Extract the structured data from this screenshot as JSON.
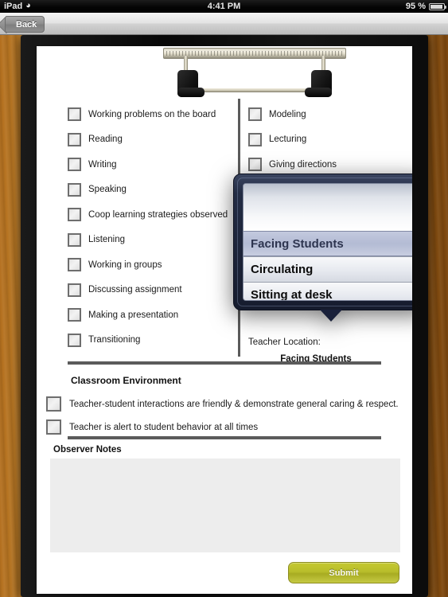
{
  "status_bar": {
    "carrier": "iPad",
    "wifi_icon": "wifi-icon",
    "time": "4:41 PM",
    "battery_percent": "95 %",
    "battery_icon": "battery-icon"
  },
  "nav_bar": {
    "back_label": "Back"
  },
  "form": {
    "left_column": [
      {
        "label": "Working problems on the board",
        "checked": false
      },
      {
        "label": "Reading",
        "checked": false
      },
      {
        "label": "Writing",
        "checked": false
      },
      {
        "label": "Speaking",
        "checked": false
      },
      {
        "label": "Coop learning strategies observed",
        "checked": false
      },
      {
        "label": "Listening",
        "checked": false
      },
      {
        "label": "Working in groups",
        "checked": false
      },
      {
        "label": "Discussing assignment",
        "checked": false
      },
      {
        "label": "Making a presentation",
        "checked": false
      },
      {
        "label": "Transitioning",
        "checked": false
      }
    ],
    "right_column": [
      {
        "label": "Modeling",
        "checked": false
      },
      {
        "label": "Lecturing",
        "checked": false
      },
      {
        "label": "Giving directions",
        "checked": false
      }
    ],
    "teacher_location": {
      "label": "Teacher Location:",
      "value": "Facing Students"
    },
    "classroom_environment": {
      "title": "Classroom Environment",
      "items": [
        {
          "label": "Teacher-student interactions are friendly & demonstrate general caring & respect.",
          "checked": false
        },
        {
          "label": "Teacher is alert to student behavior at all times",
          "checked": false
        }
      ]
    },
    "observer_notes": {
      "title": "Observer Notes",
      "value": "",
      "placeholder": ""
    },
    "submit_label": "Submit"
  },
  "picker": {
    "blank_row": "",
    "options": [
      {
        "label": "Facing Students",
        "selected": true
      },
      {
        "label": "Circulating",
        "selected": false
      },
      {
        "label": "Sitting at desk",
        "selected": false
      }
    ]
  },
  "colors": {
    "accent_submit": "#b8bd2b",
    "picker_frame": "#1c2338",
    "divider": "#5b5b5b",
    "wood": "#9a5c17"
  }
}
